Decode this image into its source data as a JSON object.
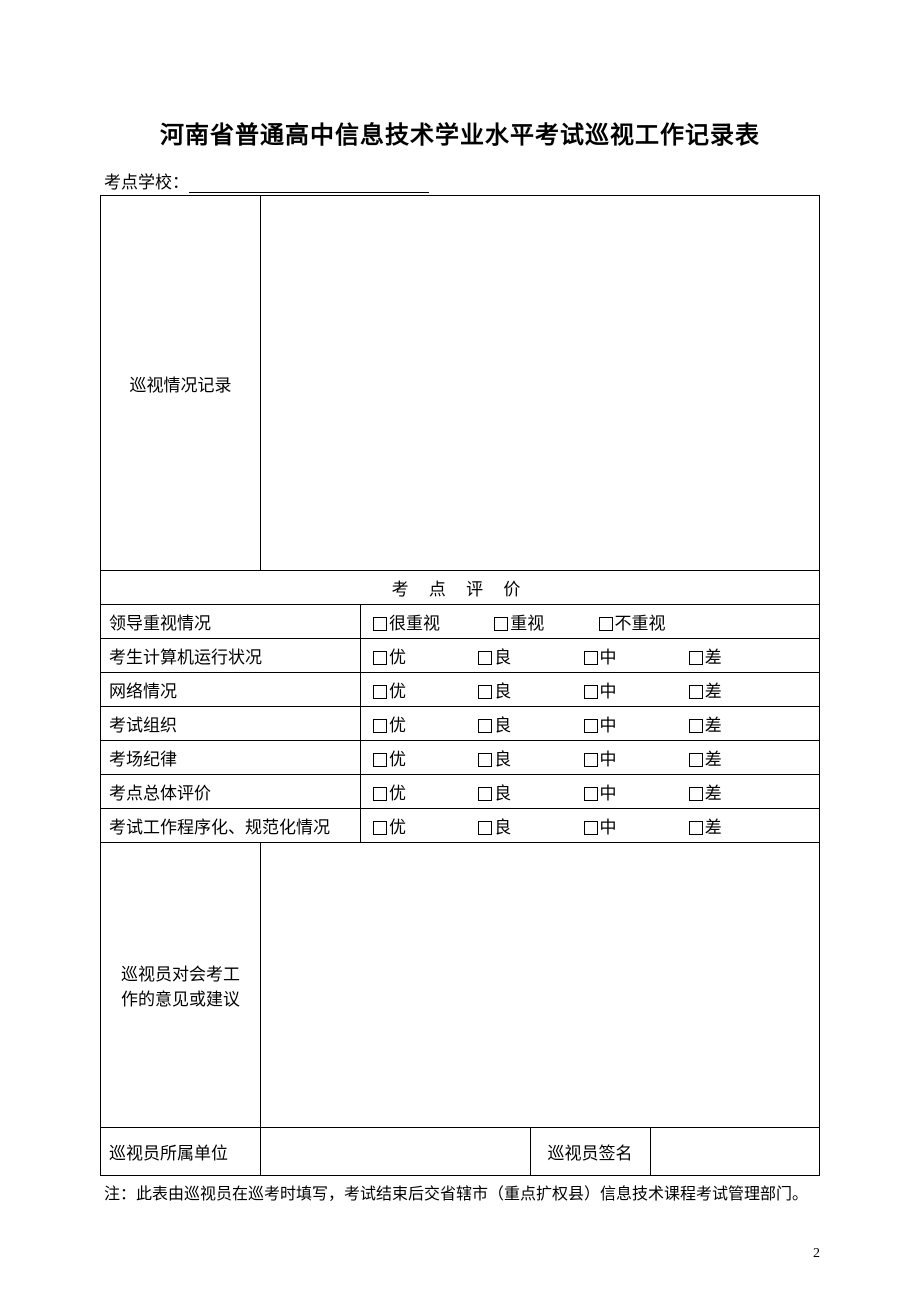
{
  "title": "河南省普通高中信息技术学业水平考试巡视工作记录表",
  "school_label": "考点学校：",
  "record_label": "巡视情况记录",
  "section_header": "考 点 评 价",
  "rows": {
    "r1": {
      "label": "领导重视情况",
      "opts": [
        "很重视",
        "重视",
        "不重视"
      ]
    },
    "r2": {
      "label": "考生计算机运行状况",
      "opts": [
        "优",
        "良",
        "中",
        "差"
      ]
    },
    "r3": {
      "label": "网络情况",
      "opts": [
        "优",
        "良",
        "中",
        "差"
      ]
    },
    "r4": {
      "label": "考试组织",
      "opts": [
        "优",
        "良",
        "中",
        "差"
      ]
    },
    "r5": {
      "label": "考场纪律",
      "opts": [
        "优",
        "良",
        "中",
        "差"
      ]
    },
    "r6": {
      "label": "考点总体评价",
      "opts": [
        "优",
        "良",
        "中",
        "差"
      ]
    },
    "r7": {
      "label": "考试工作程序化、规范化情况",
      "opts": [
        "优",
        "良",
        "中",
        "差"
      ]
    }
  },
  "opinion_label": "巡视员对会考工作的意见或建议",
  "unit_label": "巡视员所属单位",
  "sign_label": "巡视员签名",
  "note": "注：此表由巡视员在巡考时填写，考试结束后交省辖市（重点扩权县）信息技术课程考试管理部门。",
  "page_number": "2"
}
